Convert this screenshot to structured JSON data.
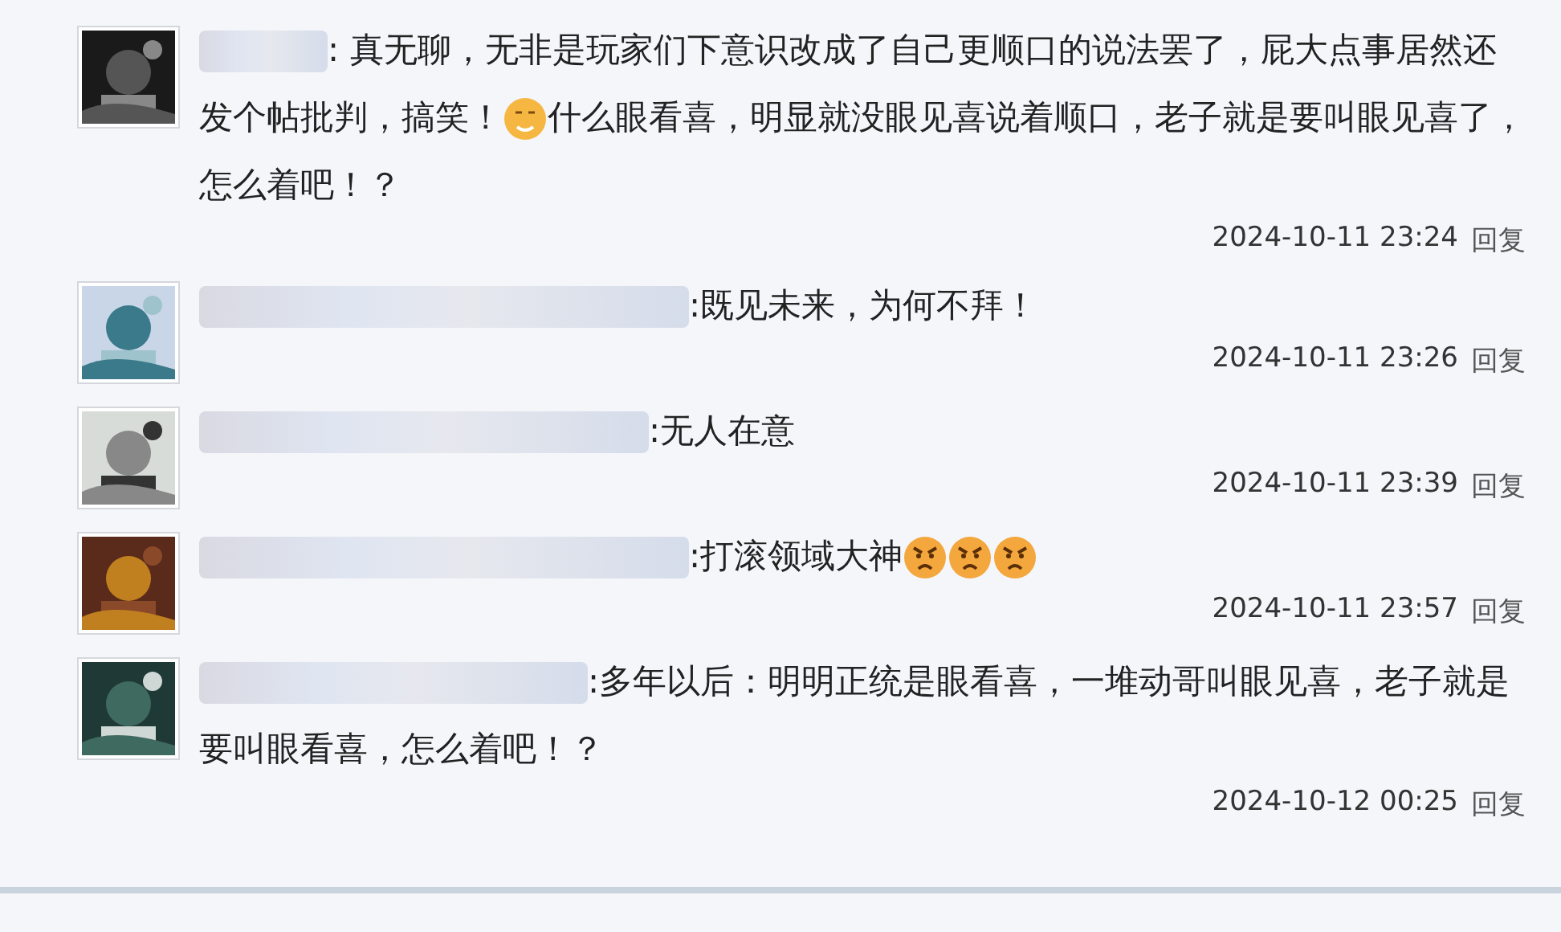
{
  "comments": [
    {
      "avatar": {
        "kind": "picture"
      },
      "content": [
        {
          "kind": "text",
          "text": ": 真无聊，无非是玩家们下意识改成了自己更顺口的说法罢了，屁大点事居然还发个帖批判，搞笑！"
        },
        {
          "kind": "smile"
        },
        {
          "kind": "text",
          "text": "什么眼看喜，明显就没眼见喜说着顺口，老子就是要叫眼见喜了，怎么着吧！？"
        }
      ],
      "time": "2024-10-11 23:24",
      "reply": "回复"
    },
    {
      "avatar": {
        "kind": "picture"
      },
      "content": [
        {
          "kind": "text",
          "text": ":既见未来，为何不拜！"
        }
      ],
      "time": "2024-10-11 23:26",
      "reply": "回复"
    },
    {
      "avatar": {
        "kind": "picture"
      },
      "content": [
        {
          "kind": "text",
          "text": ":无人在意"
        }
      ],
      "time": "2024-10-11 23:39",
      "reply": "回复"
    },
    {
      "avatar": {
        "kind": "picture"
      },
      "content": [
        {
          "kind": "text",
          "text": ":打滚领域大神"
        },
        {
          "kind": "angry"
        },
        {
          "kind": "angry"
        },
        {
          "kind": "angry"
        }
      ],
      "time": "2024-10-11 23:57",
      "reply": "回复"
    },
    {
      "avatar": {
        "kind": "picture"
      },
      "content": [
        {
          "kind": "text",
          "text": ":多年以后：明明正统是眼看喜，一堆动哥叫眼见喜，老子就是要叫眼看喜，怎么着吧！？"
        }
      ],
      "time": "2024-10-12 00:25",
      "reply": "回复"
    }
  ]
}
